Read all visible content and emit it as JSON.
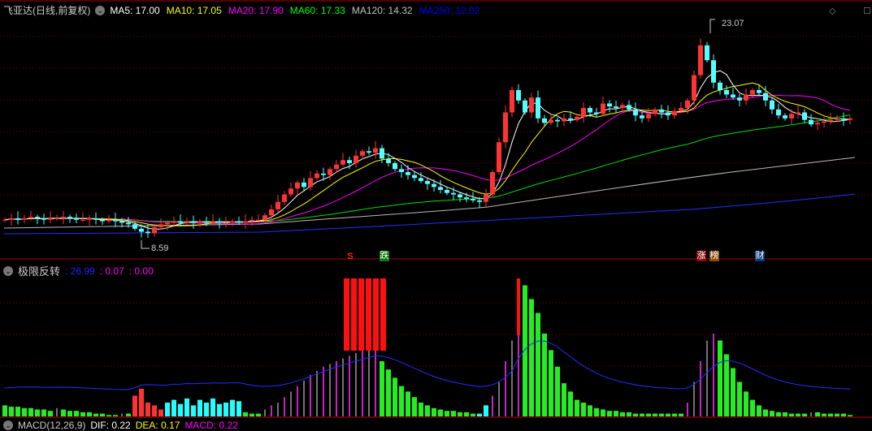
{
  "header": {
    "title": "飞亚达(日线,前复权)",
    "ma": [
      {
        "label": "MA5: 17.00",
        "color": "#ffffff"
      },
      {
        "label": "MA10: 17.05",
        "color": "#ffff00"
      },
      {
        "label": "MA20: 17.90",
        "color": "#ff00ff"
      },
      {
        "label": "MA60: 17.33",
        "color": "#00ff00"
      },
      {
        "label": "MA120: 14.32",
        "color": "#c0c0c0"
      },
      {
        "label": "MA250: 12.02",
        "color": "#0000ff"
      }
    ]
  },
  "main": {
    "high_label": "23.07",
    "low_label": "8.59",
    "markers": [
      {
        "text": "S",
        "bg": "transparent",
        "color": "#ff2020"
      },
      {
        "text": "跌",
        "bg": "#0a7a0a",
        "color": "#ffffff"
      },
      {
        "text": "涨",
        "bg": "#8a0a0a",
        "color": "#ffffff"
      },
      {
        "text": "榜",
        "bg": "#8a4a0a",
        "color": "#ffffff"
      },
      {
        "text": "财",
        "bg": "#0a3a7a",
        "color": "#ffffff"
      }
    ]
  },
  "indicator": {
    "name": "极限反转",
    "v1": ": 26.99",
    "v2": ": 0.07",
    "v3": ": 0.00"
  },
  "macd": {
    "name": "MACD(12,26,9)",
    "dif": "DIF: 0.22",
    "dea": "DEA: 0.17",
    "macd": "MACD: 0.22"
  },
  "chart_data": {
    "type": "candlestick",
    "price_range": [
      8.59,
      23.07
    ],
    "closes": [
      9.8,
      9.9,
      9.8,
      9.9,
      10.0,
      9.9,
      9.8,
      9.9,
      9.9,
      10.0,
      9.9,
      9.8,
      9.8,
      9.9,
      9.8,
      9.7,
      9.8,
      9.7,
      9.6,
      9.5,
      9.2,
      9.0,
      8.9,
      9.3,
      9.5,
      9.6,
      9.7,
      9.6,
      9.7,
      9.6,
      9.7,
      9.6,
      9.7,
      9.6,
      9.6,
      9.7,
      9.6,
      9.7,
      9.8,
      9.8,
      10.1,
      10.5,
      11.0,
      11.5,
      11.9,
      12.3,
      12.0,
      12.6,
      12.9,
      12.8,
      13.2,
      13.5,
      13.8,
      13.6,
      14.1,
      14.4,
      14.3,
      14.6,
      13.9,
      13.6,
      13.2,
      13.0,
      12.8,
      12.6,
      12.4,
      12.2,
      12.0,
      11.8,
      11.6,
      11.5,
      11.3,
      11.2,
      11.1,
      11.0,
      11.5,
      13.0,
      15.0,
      17.0,
      18.5,
      17.8,
      17.0,
      18.0,
      16.6,
      16.3,
      16.5,
      16.4,
      16.6,
      16.5,
      16.7,
      17.3,
      17.0,
      16.9,
      17.6,
      17.4,
      17.3,
      17.5,
      17.2,
      16.8,
      16.6,
      16.9,
      17.2,
      17.0,
      16.8,
      17.1,
      17.3,
      17.8,
      19.5,
      21.5,
      20.5,
      19.0,
      18.5,
      18.2,
      18.0,
      17.8,
      18.2,
      18.5,
      18.3,
      17.8,
      17.2,
      16.8,
      16.6,
      16.9,
      17.0,
      16.5,
      16.2,
      16.3,
      16.4,
      16.5,
      16.6,
      16.5,
      16.6
    ],
    "indicator_values": [
      8,
      7,
      7,
      6,
      6,
      5,
      5,
      4,
      6,
      5,
      4,
      4,
      3,
      3,
      2,
      2,
      1,
      1,
      2,
      2,
      15,
      20,
      10,
      8,
      5,
      10,
      12,
      9,
      13,
      8,
      12,
      10,
      13,
      9,
      10,
      12,
      11,
      3,
      2,
      2,
      5,
      8,
      10,
      14,
      18,
      22,
      26,
      30,
      33,
      36,
      38,
      40,
      42,
      44,
      46,
      48,
      50,
      52,
      40,
      34,
      28,
      22,
      18,
      14,
      10,
      8,
      6,
      5,
      4,
      4,
      3,
      3,
      2,
      2,
      8,
      15,
      25,
      40,
      55,
      100,
      95,
      85,
      75,
      60,
      48,
      36,
      24,
      18,
      12,
      10,
      8,
      6,
      5,
      4,
      4,
      3,
      3,
      2,
      2,
      2,
      2,
      2,
      2,
      2,
      2,
      10,
      25,
      40,
      55,
      60,
      55,
      45,
      35,
      25,
      18,
      12,
      8,
      5,
      4,
      3,
      3,
      2,
      2,
      2,
      3,
      3,
      2,
      2,
      2,
      2,
      1
    ],
    "indicator_range": [
      0,
      100
    ]
  }
}
